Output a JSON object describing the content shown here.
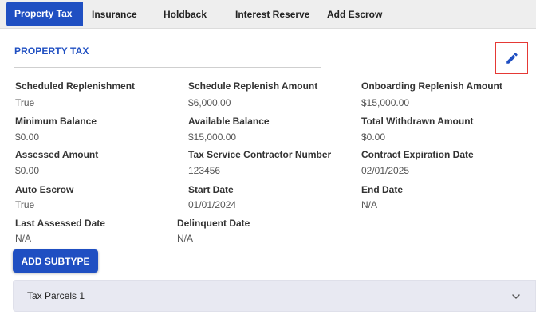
{
  "tabs": [
    {
      "label": "Property Tax",
      "active": true
    },
    {
      "label": "Insurance",
      "active": false
    },
    {
      "label": "Holdback",
      "active": false
    },
    {
      "label": "Interest Reserve",
      "active": false
    },
    {
      "label": "Add Escrow",
      "active": false
    }
  ],
  "section": {
    "title": "PROPERTY TAX",
    "edit_icon": "pencil-icon"
  },
  "fields": [
    {
      "label": "Scheduled Replenishment",
      "value": "True"
    },
    {
      "label": "Schedule Replenish Amount",
      "value": "$6,000.00"
    },
    {
      "label": "Onboarding Replenish Amount",
      "value": "$15,000.00"
    },
    {
      "label": "Minimum Balance",
      "value": "$0.00"
    },
    {
      "label": "Available Balance",
      "value": "$15,000.00"
    },
    {
      "label": "Total Withdrawn Amount",
      "value": "$0.00"
    },
    {
      "label": "Assessed Amount",
      "value": "$0.00"
    },
    {
      "label": "Tax Service Contractor Number",
      "value": "123456"
    },
    {
      "label": "Contract Expiration Date",
      "value": "02/01/2025"
    },
    {
      "label": "Auto Escrow",
      "value": "True"
    },
    {
      "label": "Start Date",
      "value": "01/01/2024"
    },
    {
      "label": "End Date",
      "value": "N/A"
    },
    {
      "label": "Last Assessed Date",
      "value": "N/A"
    },
    {
      "label": "Delinquent Date",
      "value": "N/A"
    }
  ],
  "add_subtype_label": "ADD SUBTYPE",
  "accordion": {
    "title": "Tax Parcels 1",
    "icon": "chevron-down-icon"
  },
  "colors": {
    "accent": "#1f4fc2",
    "edit_highlight": "#e53935",
    "accordion_bg": "#e8e9f2"
  }
}
